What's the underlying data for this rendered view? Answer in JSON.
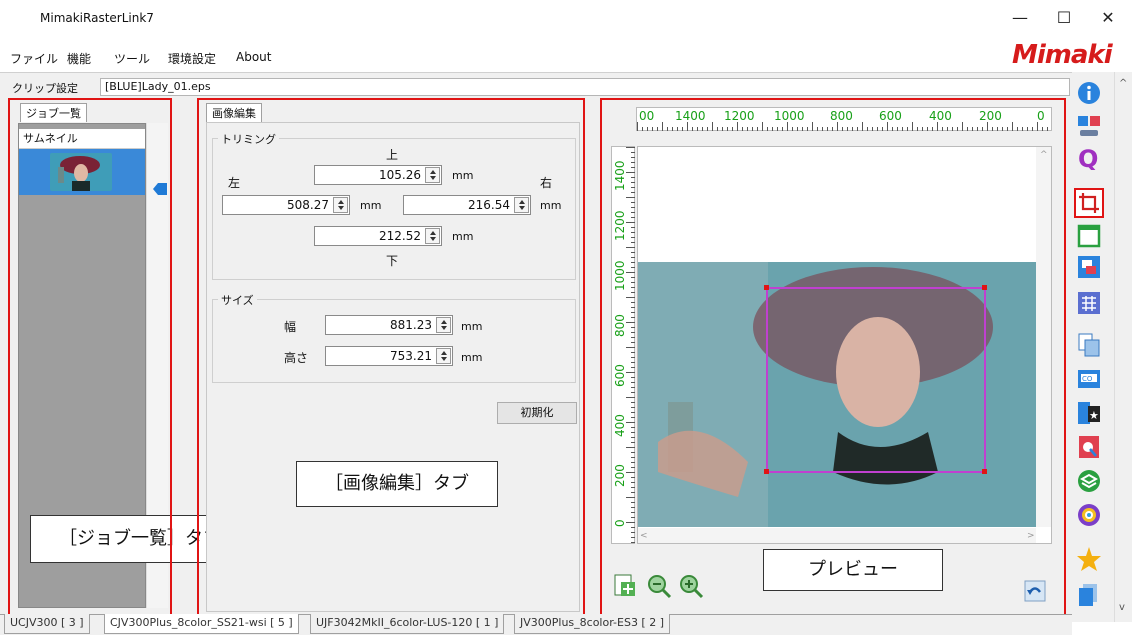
{
  "window": {
    "title": "MimakiRasterLink7",
    "min": "—",
    "max": "☐",
    "close": "✕"
  },
  "menu": [
    "ファイル",
    "機能",
    "ツール",
    "環境設定",
    "About"
  ],
  "logo": "Mimaki",
  "clip": {
    "label": "クリップ設定",
    "file": "[BLUE]Lady_01.eps"
  },
  "joblist": {
    "tab": "ジョブ一覧",
    "header": "サムネイル",
    "callout": "［ジョブ一覧］タブ"
  },
  "imgedit": {
    "tab": "画像編集",
    "trimming": {
      "label": "トリミング",
      "top_label": "上",
      "left_label": "左",
      "right_label": "右",
      "bottom_label": "下",
      "top": "105.26",
      "left": "508.27",
      "right": "216.54",
      "bottom": "212.52"
    },
    "size": {
      "label": "サイズ",
      "width_label": "幅",
      "height_label": "高さ",
      "width": "881.23",
      "height": "753.21"
    },
    "unit": "mm",
    "reset": "初期化",
    "callout": "［画像編集］タブ"
  },
  "preview": {
    "h_ticks": [
      "00",
      "1400",
      "1200",
      "1000",
      "800",
      "600",
      "400",
      "200",
      "0"
    ],
    "v_ticks": [
      "1400",
      "1200",
      "1000",
      "800",
      "600",
      "400",
      "200",
      "0"
    ],
    "callout": "プレビュー"
  },
  "printer_tabs": [
    "UCJV300 [ 3 ]",
    "CJV300Plus_8color_SS21-wsi [ 5 ]",
    "UJF3042MkII_6color-LUS-120 [ 1 ]",
    "JV300Plus_8color-ES3 [ 2 ]"
  ],
  "colors": {
    "highlight": "#e01414",
    "ruler_text": "#18a018",
    "selection": "#3a89d8"
  }
}
